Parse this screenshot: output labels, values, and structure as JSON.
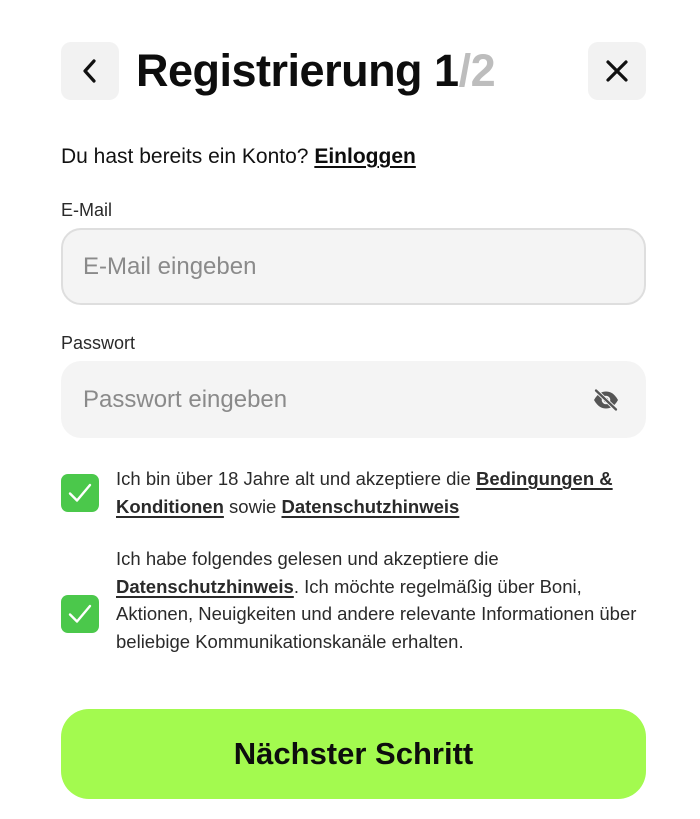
{
  "header": {
    "title": "Registrierung 1",
    "step_total": "/2",
    "back_icon": "chevron-left-icon",
    "close_icon": "close-icon"
  },
  "login": {
    "prompt": "Du hast bereits ein Konto? ",
    "link_label": "Einloggen"
  },
  "email": {
    "label": "E-Mail",
    "placeholder": "E-Mail eingeben",
    "value": ""
  },
  "password": {
    "label": "Passwort",
    "placeholder": "Passwort eingeben",
    "value": "",
    "toggle_icon": "eye-off-icon"
  },
  "consents": [
    {
      "checked": true,
      "text_before": "Ich bin über 18 Jahre alt und akzeptiere die ",
      "link1": "Bedingungen & Konditionen",
      "text_middle": " sowie ",
      "link2": "Datenschutzhinweis",
      "text_after": ""
    },
    {
      "checked": true,
      "text_before": "Ich habe folgendes gelesen und akzeptiere die ",
      "link1": "Datenschutzhinweis",
      "text_after": ". Ich möchte regelmäßig über Boni, Aktionen, Neuigkeiten und andere relevante Informationen über beliebige Kommunikationskanäle erhalten."
    }
  ],
  "submit": {
    "label": "Nächster Schritt"
  },
  "colors": {
    "accent_button": "#a3fa4f",
    "checkbox": "#4bc84b",
    "input_bg": "#f4f4f4",
    "icon_button_bg": "#f2f2f2",
    "muted_step": "#bdbdbd"
  }
}
